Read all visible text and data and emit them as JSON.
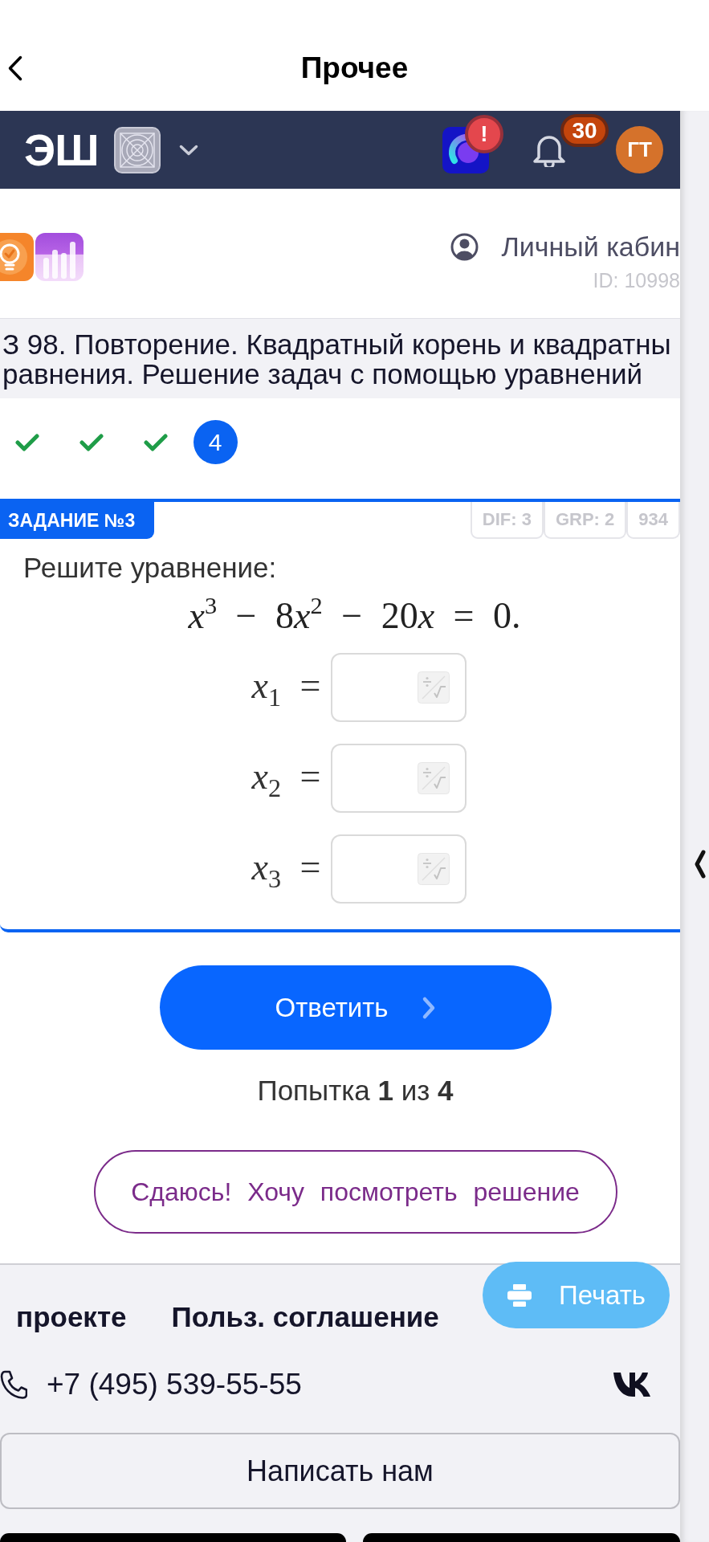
{
  "header": {
    "title": "Прочее"
  },
  "navbar": {
    "logo": "ЭШ",
    "alert_badge": "!",
    "notification_count": "30",
    "avatar_initials": "ГТ"
  },
  "account": {
    "label": "Личный кабин",
    "user_id": "ID: 10998"
  },
  "lesson": {
    "title_lines": [
      "З 98. Повторение. Квадратный корень и квадратны",
      "равнения. Решение задач с помощью уравнений"
    ]
  },
  "steps": [
    {
      "kind": "done",
      "selected": false
    },
    {
      "kind": "done",
      "selected": false
    },
    {
      "kind": "done",
      "selected": false
    },
    {
      "kind": "number",
      "label": "4",
      "selected": true
    }
  ],
  "task": {
    "badge": "ЗАДАНИЕ №3",
    "tags": [
      "DIF: 3",
      "GRP: 2",
      "934"
    ],
    "prompt": "Решите уравнение:",
    "equation": [
      {
        "kind": "var",
        "text": "x",
        "sup": "3"
      },
      {
        "kind": "op",
        "text": "−"
      },
      {
        "kind": "num",
        "text": "8"
      },
      {
        "kind": "var",
        "text": "x",
        "sup": "2"
      },
      {
        "kind": "op",
        "text": "−"
      },
      {
        "kind": "num",
        "text": "20"
      },
      {
        "kind": "var",
        "text": "x"
      },
      {
        "kind": "op",
        "text": "="
      },
      {
        "kind": "num",
        "text": "0."
      }
    ],
    "answers": [
      {
        "label": "*x*$_{1}$ ="
      },
      {
        "label": "*x*$_{2}$ ="
      },
      {
        "label": "*x*$_{3}$ ="
      }
    ]
  },
  "actions": {
    "submit": "Ответить",
    "attempt": "Попытка **1** из **4**",
    "give_up": "Сдаюсь! Хочу посмотреть решение"
  },
  "print_button": "Печать",
  "footer": {
    "links": [
      "проекте",
      "Польз. соглашение"
    ],
    "phone": "+7 (495) 539-55-55",
    "contact_button": "Написать нам"
  }
}
